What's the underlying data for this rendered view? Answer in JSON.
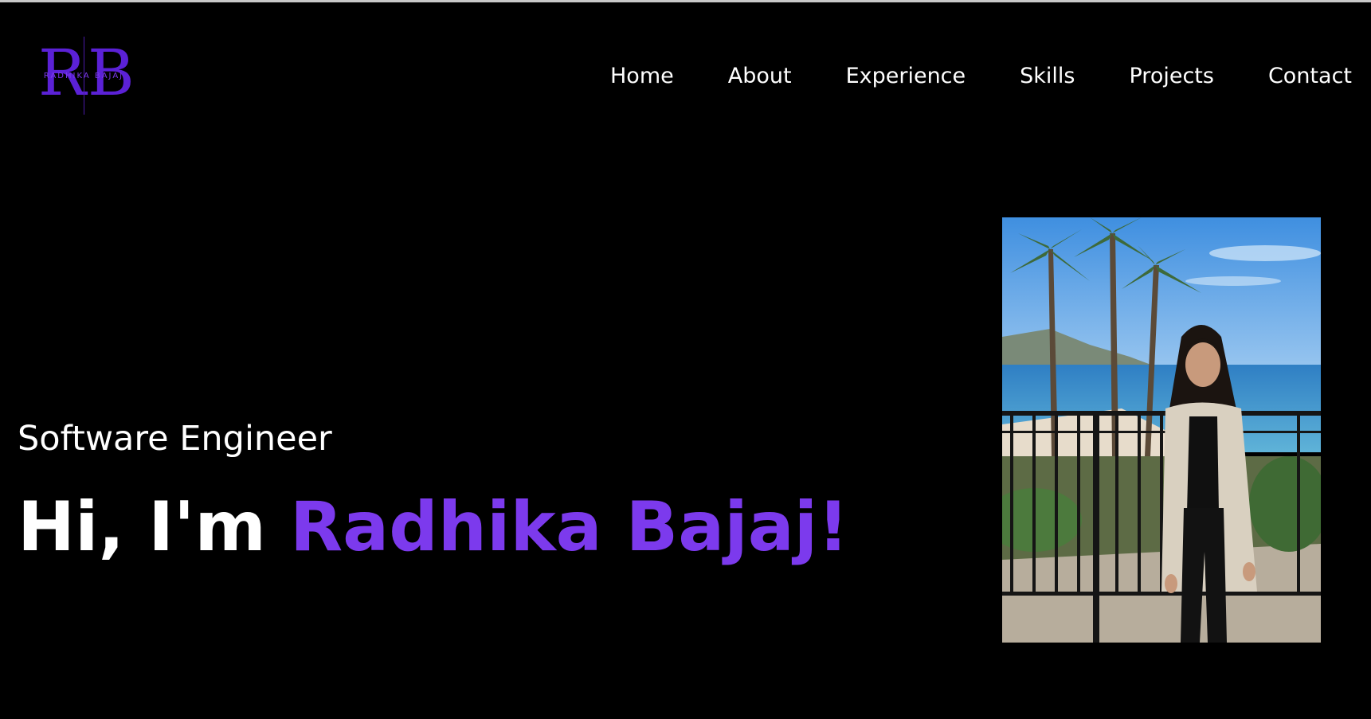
{
  "logo": {
    "initial_left": "R",
    "initial_right": "B",
    "wordmark": "RADHIKA BAJAJ"
  },
  "nav": {
    "items": [
      "Home",
      "About",
      "Experience",
      "Skills",
      "Projects",
      "Contact"
    ]
  },
  "hero": {
    "subtitle": "Software Engineer",
    "greeting": "Hi, I'm ",
    "name": "Radhika Bajaj!"
  },
  "colors": {
    "background": "#000000",
    "accent": "#7c3aed",
    "text": "#ffffff"
  }
}
